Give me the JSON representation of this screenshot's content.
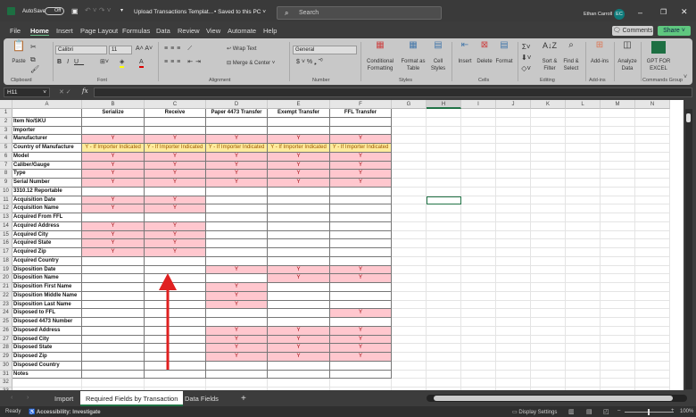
{
  "titlebar": {
    "autosave": "AutoSave",
    "toggle": "Off",
    "filename": "Upload Transactions Templat...",
    "saved": "• Saved to this PC ˅",
    "search": "Search",
    "user": "Ethan Carroll",
    "initials": "EC"
  },
  "menu": [
    "File",
    "Home",
    "Insert",
    "Page Layout",
    "Formulas",
    "Data",
    "Review",
    "View",
    "Automate",
    "Help"
  ],
  "actions": {
    "comments": "Comments",
    "share": "Share"
  },
  "ribbon": {
    "paste": "Paste",
    "font": "Calibri",
    "size": "11",
    "wrap": "Wrap Text",
    "merge": "Merge & Center",
    "number_format": "General",
    "cond": "Conditional Formatting",
    "fmt_table": "Format as Table",
    "cell_styles": "Cell Styles",
    "insert": "Insert",
    "delete": "Delete",
    "format": "Format",
    "sort": "Sort & Filter",
    "find": "Find & Select",
    "addins": "Add-ins",
    "analyze": "Analyze Data",
    "gpt": "GPT FOR EXCEL",
    "groups": [
      "Clipboard",
      "Font",
      "Alignment",
      "Number",
      "Styles",
      "Cells",
      "Editing",
      "Add-ins",
      "Commands Group"
    ]
  },
  "namebox": "H11",
  "fx": "fx",
  "columns": [
    "A",
    "B",
    "C",
    "D",
    "E",
    "F",
    "G",
    "H",
    "I",
    "J",
    "K",
    "L",
    "M",
    "N"
  ],
  "sheet": {
    "headers": [
      "",
      "Serialize",
      "Receive",
      "Paper 4473 Transfer",
      "Exempt Transfer",
      "FFL Transfer"
    ],
    "rows": [
      [
        "Item No/SKU",
        "",
        "",
        "",
        "",
        ""
      ],
      [
        "Importer",
        "",
        "",
        "",
        "",
        ""
      ],
      [
        "Manufacturer",
        "Y",
        "Y",
        "Y",
        "Y",
        "Y"
      ],
      [
        "Country of Manufacture",
        "Y - If Importer Indicated",
        "Y - If Importer Indicated",
        "Y - If Importer Indicated",
        "Y - If Importer Indicated",
        "Y - If Importer Indicated"
      ],
      [
        "Model",
        "Y",
        "Y",
        "Y",
        "Y",
        "Y"
      ],
      [
        "Caliber/Gauge",
        "Y",
        "Y",
        "Y",
        "Y",
        "Y"
      ],
      [
        "Type",
        "Y",
        "Y",
        "Y",
        "Y",
        "Y"
      ],
      [
        "Serial Number",
        "Y",
        "Y",
        "Y",
        "Y",
        "Y"
      ],
      [
        "3310.12 Reportable",
        "",
        "",
        "",
        "",
        ""
      ],
      [
        "Acquisition Date",
        "Y",
        "Y",
        "",
        "",
        ""
      ],
      [
        "Acquisition Name",
        "Y",
        "Y",
        "",
        "",
        ""
      ],
      [
        "Acquired From FFL",
        "",
        "",
        "",
        "",
        ""
      ],
      [
        "Acquired Address",
        "Y",
        "Y",
        "",
        "",
        ""
      ],
      [
        "Acquired City",
        "Y",
        "Y",
        "",
        "",
        ""
      ],
      [
        "Acquired State",
        "Y",
        "Y",
        "",
        "",
        ""
      ],
      [
        "Acquired Zip",
        "Y",
        "Y",
        "",
        "",
        ""
      ],
      [
        "Acquired Country",
        "",
        "",
        "",
        "",
        ""
      ],
      [
        "Disposition Date",
        "",
        "",
        "Y",
        "Y",
        "Y"
      ],
      [
        "Disposition Name",
        "",
        "",
        "",
        "Y",
        "Y"
      ],
      [
        "Disposition First Name",
        "",
        "",
        "Y",
        "",
        ""
      ],
      [
        "Disposition Middle Name",
        "",
        "",
        "Y",
        "",
        ""
      ],
      [
        "Disposition Last Name",
        "",
        "",
        "Y",
        "",
        ""
      ],
      [
        "Disposed to FFL",
        "",
        "",
        "",
        "",
        "Y"
      ],
      [
        "Disposed 4473 Number",
        "",
        "",
        "",
        "",
        ""
      ],
      [
        "Disposed Address",
        "",
        "",
        "Y",
        "Y",
        "Y"
      ],
      [
        "Disposed City",
        "",
        "",
        "Y",
        "Y",
        "Y"
      ],
      [
        "Disposed State",
        "",
        "",
        "Y",
        "Y",
        "Y"
      ],
      [
        "Disposed Zip",
        "",
        "",
        "Y",
        "Y",
        "Y"
      ],
      [
        "Disposed Country",
        "",
        "",
        "",
        "",
        ""
      ],
      [
        "Notes",
        "",
        "",
        "",
        "",
        ""
      ]
    ]
  },
  "selected_cell": "H11",
  "sheet_tabs": [
    "Import",
    "Required Fields by Transaction",
    "Data Fields"
  ],
  "active_tab": 1,
  "status": {
    "ready": "Ready",
    "accessibility": "Accessibility: Investigate",
    "display": "Display Settings",
    "zoom": "100%"
  },
  "colors": {
    "pink": "#ffc7ce",
    "yellow": "#ffeb9c",
    "arrow": "#e02020",
    "accent": "#217346"
  }
}
